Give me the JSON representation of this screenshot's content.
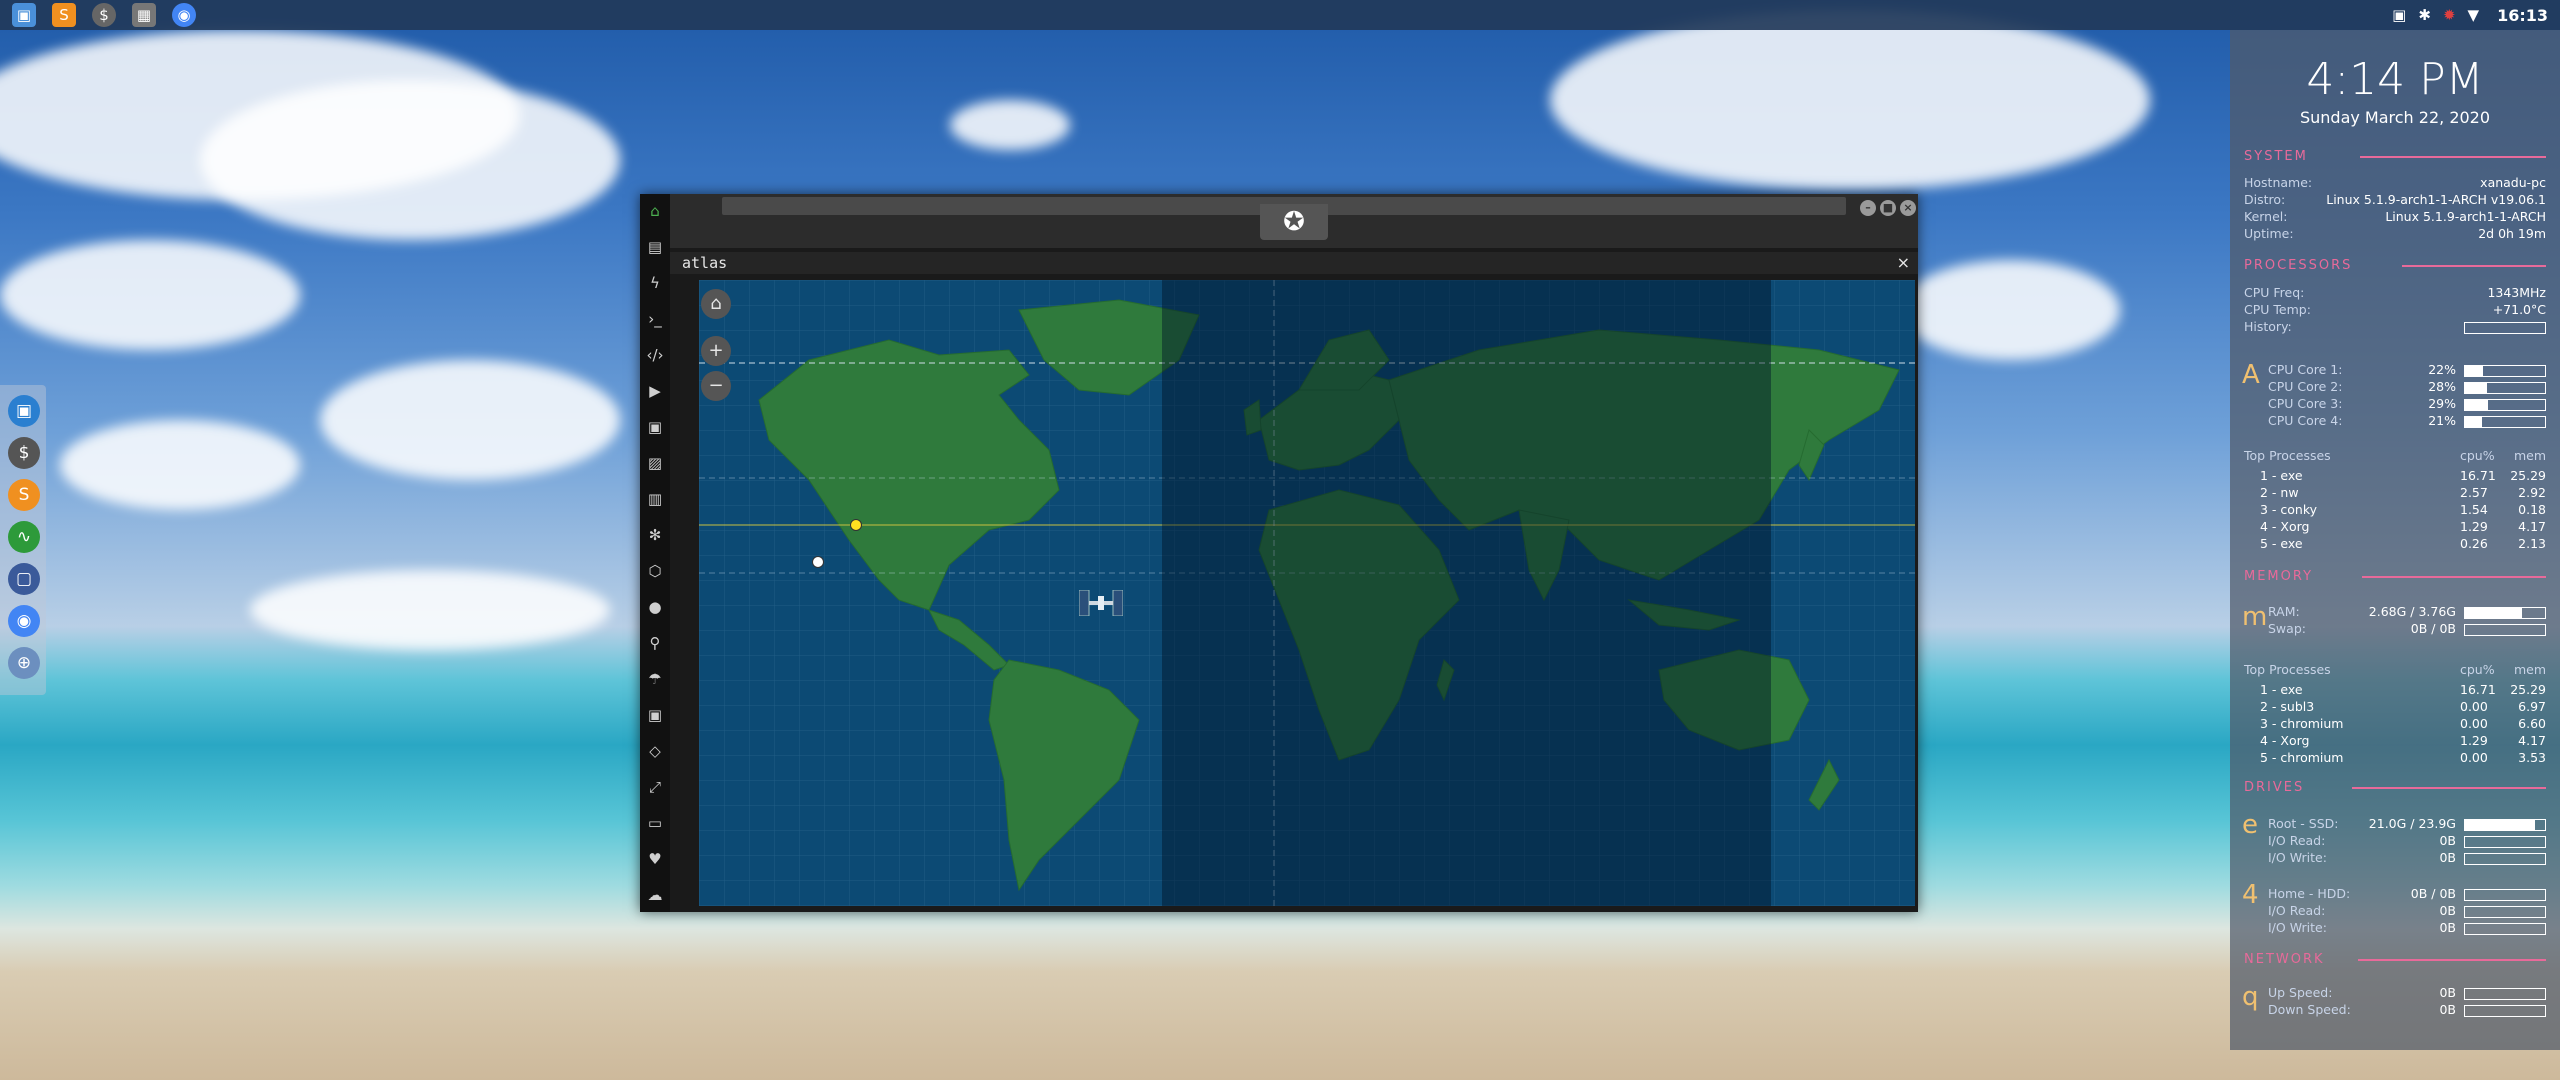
{
  "top_panel": {
    "apps": [
      {
        "name": "files-icon",
        "glyph": "▣",
        "color": "#4a90d9"
      },
      {
        "name": "sublime-icon",
        "glyph": "S",
        "color": "#f09020"
      },
      {
        "name": "terminal-money-icon",
        "glyph": "$",
        "color": "#666666"
      },
      {
        "name": "workspace-icon",
        "glyph": "▦",
        "color": "#777777"
      },
      {
        "name": "chrome-icon",
        "glyph": "◉",
        "color": "#4285f4"
      }
    ],
    "clock": "16:13"
  },
  "dock": {
    "items": [
      "files-icon",
      "terminal-money-icon",
      "sublime-icon",
      "system-monitor-icon",
      "screenshot-icon",
      "chrome-icon",
      "globe-icon"
    ]
  },
  "atlas": {
    "tab_title": "atlas",
    "close": "×",
    "toolbar_icons": [
      "home-icon",
      "document-icon",
      "bolt-icon",
      "terminal-icon",
      "code-icon",
      "play-icon",
      "scan-icon",
      "image-icon",
      "newspaper-icon",
      "atom-icon",
      "hexagon-icon",
      "globe-icon",
      "search-icon",
      "umbrella-icon",
      "contact-icon",
      "pair-icon",
      "expand-icon",
      "youtube-icon",
      "heart-icon",
      "cloud-icon"
    ],
    "map_controls": {
      "home": "⌂",
      "zoom_in": "+",
      "zoom_out": "−"
    }
  },
  "conky": {
    "time": "4:14 PM",
    "date": "Sunday March 22, 2020",
    "system": {
      "heading": "SYSTEM",
      "rows": [
        {
          "label": "Hostname:",
          "value": "xanadu-pc"
        },
        {
          "label": "Distro:",
          "value": "Linux 5.1.9-arch1-1-ARCH v19.06.1"
        },
        {
          "label": "Kernel:",
          "value": "Linux 5.1.9-arch1-1-ARCH"
        },
        {
          "label": "Uptime:",
          "value": "2d 0h 19m"
        }
      ]
    },
    "processors": {
      "heading": "PROCESSORS",
      "rows": [
        {
          "label": "CPU Freq:",
          "value": "1343MHz"
        },
        {
          "label": "CPU Temp:",
          "value": "+71.0°C"
        },
        {
          "label": "History:",
          "value": ""
        }
      ],
      "glyph": "A",
      "cores": [
        {
          "label": "CPU Core 1:",
          "value": "22%",
          "level": 0.22
        },
        {
          "label": "CPU Core 2:",
          "value": "28%",
          "level": 0.28
        },
        {
          "label": "CPU Core 3:",
          "value": "29%",
          "level": 0.29
        },
        {
          "label": "CPU Core 4:",
          "value": "21%",
          "level": 0.21
        }
      ],
      "top_heading": "Top Processes",
      "col1": "cpu%",
      "col2": "mem",
      "procs": [
        {
          "n": "1 - exe",
          "cpu": "16.71",
          "mem": "25.29"
        },
        {
          "n": "2 - nw",
          "cpu": "2.57",
          "mem": "2.92"
        },
        {
          "n": "3 - conky",
          "cpu": "1.54",
          "mem": "0.18"
        },
        {
          "n": "4 - Xorg",
          "cpu": "1.29",
          "mem": "4.17"
        },
        {
          "n": "5 - exe",
          "cpu": "0.26",
          "mem": "2.13"
        }
      ]
    },
    "memory": {
      "heading": "MEMORY",
      "glyph": "m",
      "rows": [
        {
          "label": "RAM:",
          "value": "2.68G / 3.76G",
          "level": 0.71
        },
        {
          "label": "Swap:",
          "value": "0B / 0B",
          "level": 0
        }
      ],
      "top_heading": "Top Processes",
      "col1": "cpu%",
      "col2": "mem",
      "procs": [
        {
          "n": "1 - exe",
          "cpu": "16.71",
          "mem": "25.29"
        },
        {
          "n": "2 - subl3",
          "cpu": "0.00",
          "mem": "6.97"
        },
        {
          "n": "3 - chromium",
          "cpu": "0.00",
          "mem": "6.60"
        },
        {
          "n": "4 - Xorg",
          "cpu": "1.29",
          "mem": "4.17"
        },
        {
          "n": "5 - chromium",
          "cpu": "0.00",
          "mem": "3.53"
        }
      ]
    },
    "drives": {
      "heading": "DRIVES",
      "glyph1": "e",
      "glyph2": "4",
      "rows1": [
        {
          "label": "Root - SSD:",
          "value": "21.0G / 23.9G",
          "level": 0.88
        },
        {
          "label": "I/O Read:",
          "value": "0B",
          "level": 0
        },
        {
          "label": "I/O Write:",
          "value": "0B",
          "level": 0
        }
      ],
      "rows2": [
        {
          "label": "Home - HDD:",
          "value": "0B / 0B",
          "level": 0
        },
        {
          "label": "I/O Read:",
          "value": "0B",
          "level": 0
        },
        {
          "label": "I/O Write:",
          "value": "0B",
          "level": 0
        }
      ]
    },
    "network": {
      "heading": "NETWORK",
      "glyph": "q",
      "rows": [
        {
          "label": "Up Speed:",
          "value": "0B",
          "level": 0
        },
        {
          "label": "Down Speed:",
          "value": "0B",
          "level": 0
        }
      ]
    }
  }
}
